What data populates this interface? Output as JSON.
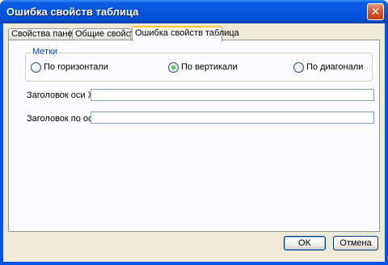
{
  "window": {
    "title": "Ошибка свойств таблица",
    "close_glyph": "✕"
  },
  "tabs": [
    {
      "label": "Свойства панели",
      "active": false
    },
    {
      "label": "Общие свойства",
      "active": false
    },
    {
      "label": "Ошибка свойств таблица",
      "active": true
    }
  ],
  "labels_group": {
    "title": "Метки",
    "options": [
      {
        "label": "По горизонтали",
        "selected": false
      },
      {
        "label": "По вертикали",
        "selected": true
      },
      {
        "label": "По диагонали",
        "selected": false
      }
    ]
  },
  "fields": {
    "x_axis_title_label": "Заголовок оси X:",
    "x_axis_title_value": "",
    "axis_title_label": "Заголовок по оси",
    "axis_title_value": ""
  },
  "buttons": {
    "ok_label": "OK",
    "cancel_label": "Отмена"
  },
  "colors": {
    "title_bar": "#0054e3",
    "dialog_face": "#ece9d8",
    "group_title": "#0046d5",
    "active_tab_highlight": "#ffc83c",
    "radio_selected": "#21a121"
  }
}
